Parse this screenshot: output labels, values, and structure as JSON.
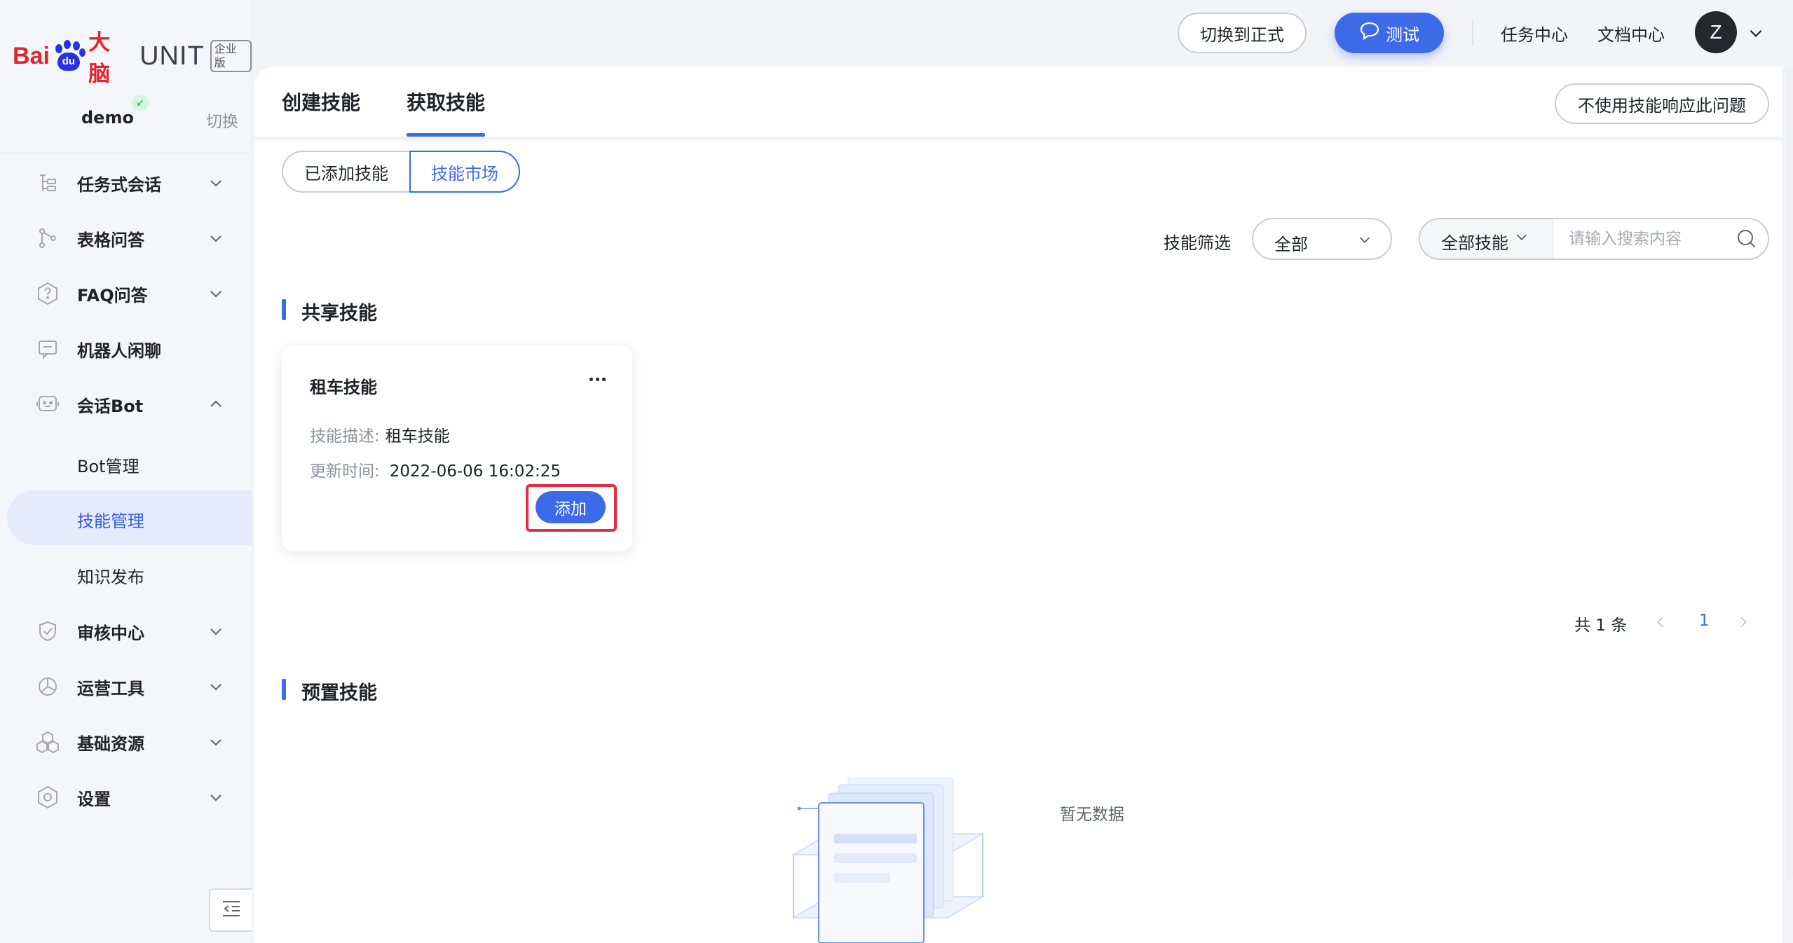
{
  "brand": {
    "bai": "Bai",
    "du": "du",
    "danao": "大脑",
    "unit": "UNIT",
    "edition": "企业版"
  },
  "project": {
    "name": "demo",
    "switch_label": "切换"
  },
  "sidebar": {
    "items": [
      {
        "label": "任务式会话",
        "icon": "task-dialog-icon"
      },
      {
        "label": "表格问答",
        "icon": "table-qa-icon"
      },
      {
        "label": "FAQ问答",
        "icon": "faq-icon"
      },
      {
        "label": "机器人闲聊",
        "icon": "chat-icon"
      },
      {
        "label": "会话Bot",
        "icon": "bot-icon"
      },
      {
        "label": "审核中心",
        "icon": "review-shield-icon"
      },
      {
        "label": "运营工具",
        "icon": "operations-icon"
      },
      {
        "label": "基础资源",
        "icon": "resources-icon"
      },
      {
        "label": "设置",
        "icon": "settings-icon"
      }
    ],
    "sub_items": [
      {
        "label": "Bot管理"
      },
      {
        "label": "技能管理"
      },
      {
        "label": "知识发布"
      }
    ]
  },
  "header": {
    "switch_formal": "切换到正式",
    "test": "测试",
    "task_center": "任务中心",
    "doc_center": "文档中心",
    "avatar_letter": "Z"
  },
  "tabs": [
    {
      "label": "创建技能"
    },
    {
      "label": "获取技能"
    }
  ],
  "no_skill_button": "不使用技能响应此问题",
  "segment": {
    "added": "已添加技能",
    "market": "技能市场"
  },
  "filter": {
    "label": "技能筛选",
    "value": "全部",
    "scope": "全部技能",
    "search_placeholder": "请输入搜索内容"
  },
  "shared": {
    "title": "共享技能",
    "card": {
      "title": "租车技能",
      "desc_key": "技能描述:",
      "desc_value": "租车技能",
      "time_key": "更新时间:",
      "time_value": "2022-06-06 16:02:25",
      "add_label": "添加"
    },
    "pager": {
      "total": "共 1 条",
      "page": "1"
    }
  },
  "preset": {
    "title": "预置技能",
    "empty_text": "暂无数据"
  },
  "colors": {
    "accent": "#3d6ae8",
    "highlight": "#e52c45",
    "baidu_red": "#e4232e",
    "baidu_blue": "#2932e1"
  }
}
